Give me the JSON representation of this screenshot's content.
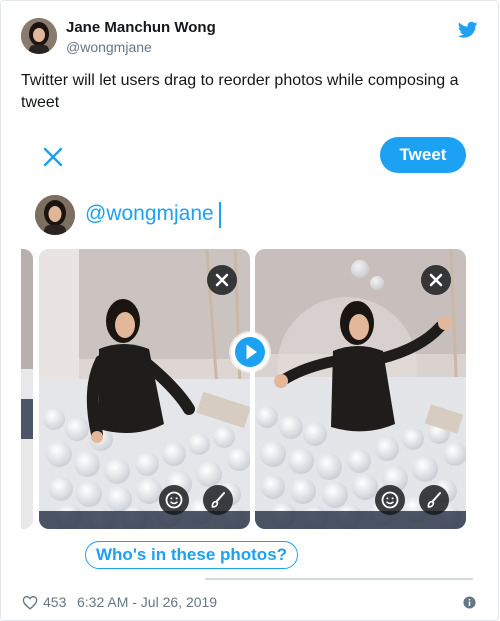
{
  "author": {
    "display_name": "Jane Manchun Wong",
    "handle": "@wongmjane"
  },
  "tweet": {
    "text": "Twitter will let users drag to reorder photos while composing a tweet"
  },
  "composer": {
    "tweet_button_label": "Tweet",
    "text_value": "@wongmjane",
    "tag_prompt": "Who's in these photos?"
  },
  "footer": {
    "likes": "453",
    "timestamp": "6:32 AM - Jul 26, 2019"
  },
  "colors": {
    "accent": "#1da1f2",
    "muted": "#657786",
    "text": "#14171a"
  },
  "icons": [
    "twitter-bird-icon",
    "close-icon",
    "remove-photo-icon",
    "sticker-icon",
    "edit-brush-icon",
    "drag-reorder-icon",
    "heart-icon",
    "info-icon"
  ]
}
